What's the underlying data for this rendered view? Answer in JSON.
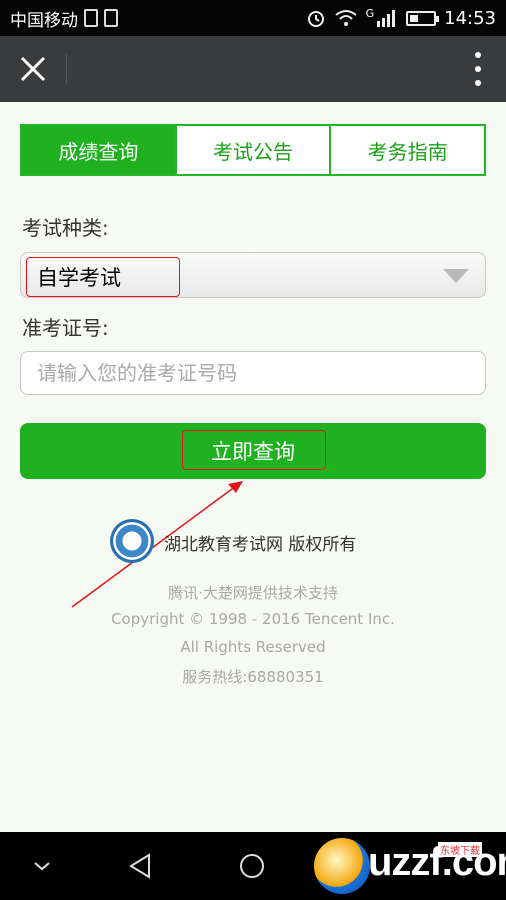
{
  "status_bar": {
    "carrier": "中国移动",
    "time": "14:53",
    "network": "G",
    "battery_level": 0.35
  },
  "navbar": {
    "close_label": "✕"
  },
  "tabs": [
    {
      "label": "成绩查询",
      "active": true
    },
    {
      "label": "考试公告",
      "active": false
    },
    {
      "label": "考务指南",
      "active": false
    }
  ],
  "form": {
    "exam_type_label": "考试种类:",
    "exam_type_value": "自学考试",
    "ticket_label": "准考证号:",
    "ticket_placeholder": "请输入您的准考证号码",
    "submit_label": "立即查询"
  },
  "footer": {
    "org": "湖北教育考试网 版权所有",
    "support": "腾讯·大楚网提供技术支持",
    "copyright": "Copyright © 1998 - 2016 Tencent Inc.",
    "rights": "All Rights Reserved",
    "hotline": "服务热线:68880351"
  },
  "watermark": {
    "text": "uzzf.com",
    "badge": "东坡下载"
  },
  "colors": {
    "accent": "#1fb11f",
    "annotation": "#e0161a",
    "navbar": "#3a3b3c"
  }
}
